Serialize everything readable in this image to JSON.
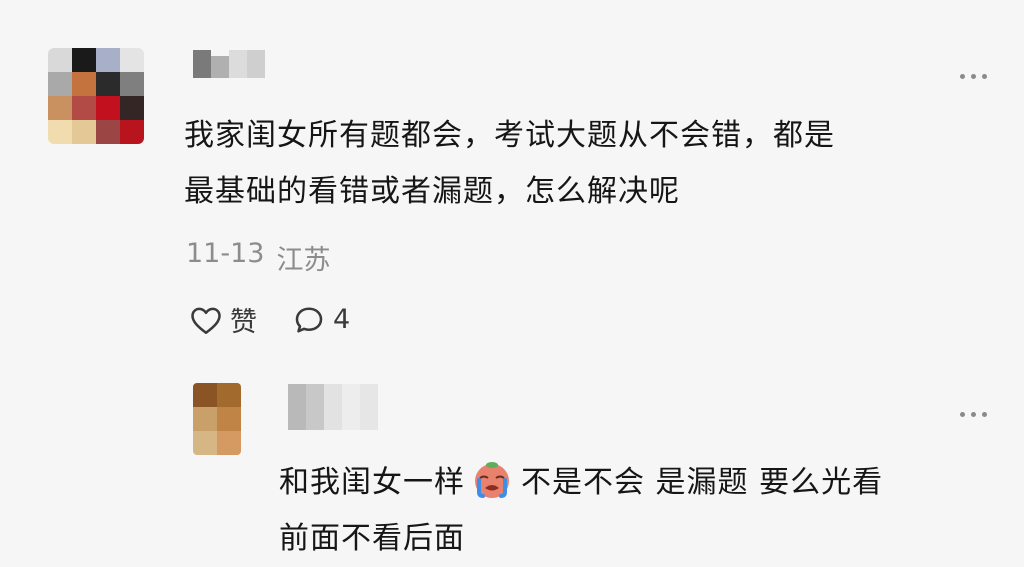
{
  "main_comment": {
    "avatar_colors": [
      "#d9d9d9",
      "#1a1a1a",
      "#a7b0c8",
      "#e4e4e4",
      "#a9a9a9",
      "#c4723e",
      "#2b2b2b",
      "#7f7f7f",
      "#c99060",
      "#b24a46",
      "#c3101e",
      "#352626",
      "#f0dcae",
      "#e4c896",
      "#9c4545",
      "#b8141e"
    ],
    "username_colors": [
      "#7a7a7a",
      "#b0b0b0",
      "#dcdcdc",
      "#cfcfcf"
    ],
    "text_lines": [
      "我家闺女所有题都会，考试大题从不会错，都是",
      "最基础的看错或者漏题，怎么解决呢"
    ],
    "date": "11-13",
    "location": "江苏",
    "like_label": "赞",
    "reply_count": "4"
  },
  "reply_comment": {
    "avatar_colors": [
      "#8a5424",
      "#a26a2c",
      "#c9a06a",
      "#bf8446",
      "#d6b684",
      "#d49a62"
    ],
    "username_colors": [
      "#b9b9b9",
      "#c8c8c8",
      "#e2e2e2",
      "#ededed",
      "#e6e6e6"
    ],
    "text_lines": [
      "和我闺女一样",
      "不是不会 是漏题 要么光看",
      "前面不看后面"
    ],
    "emoji_icon": "crying-face-emoji-icon"
  }
}
